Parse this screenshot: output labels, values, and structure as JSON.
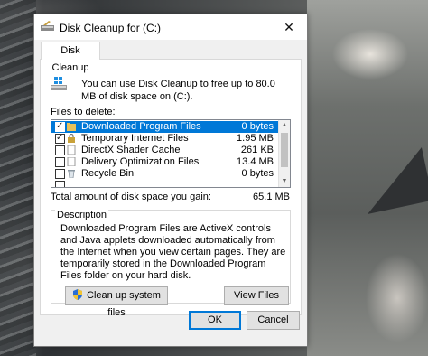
{
  "window": {
    "title": "Disk Cleanup for  (C:)",
    "close_glyph": "✕"
  },
  "tab": {
    "label": "Disk Cleanup"
  },
  "intro": {
    "text": "You can use Disk Cleanup to free up to 80.0 MB of disk space on  (C:)."
  },
  "files": {
    "label": "Files to delete:",
    "items": [
      {
        "name": "Downloaded Program Files",
        "size": "0 bytes",
        "checked": true,
        "selected": true,
        "icon": "folder-icon"
      },
      {
        "name": "Temporary Internet Files",
        "size": "1.95 MB",
        "checked": true,
        "selected": false,
        "icon": "lock-icon"
      },
      {
        "name": "DirectX Shader Cache",
        "size": "261 KB",
        "checked": false,
        "selected": false,
        "icon": "blank-file-icon"
      },
      {
        "name": "Delivery Optimization Files",
        "size": "13.4 MB",
        "checked": false,
        "selected": false,
        "icon": "blank-file-icon"
      },
      {
        "name": "Recycle Bin",
        "size": "0 bytes",
        "checked": false,
        "selected": false,
        "icon": "recycle-bin-icon"
      }
    ]
  },
  "total": {
    "label": "Total amount of disk space you gain:",
    "value": "65.1 MB"
  },
  "description": {
    "title": "Description",
    "text": "Downloaded Program Files are ActiveX controls and Java applets downloaded automatically from the Internet when you view certain pages. They are temporarily stored in the Downloaded Program Files folder on your hard disk."
  },
  "buttons": {
    "cleanup_system": "Clean up system files",
    "view_files": "View Files",
    "ok": "OK",
    "cancel": "Cancel"
  },
  "colors": {
    "selection": "#0078d7",
    "dialog_bg": "#f0f0f0"
  }
}
